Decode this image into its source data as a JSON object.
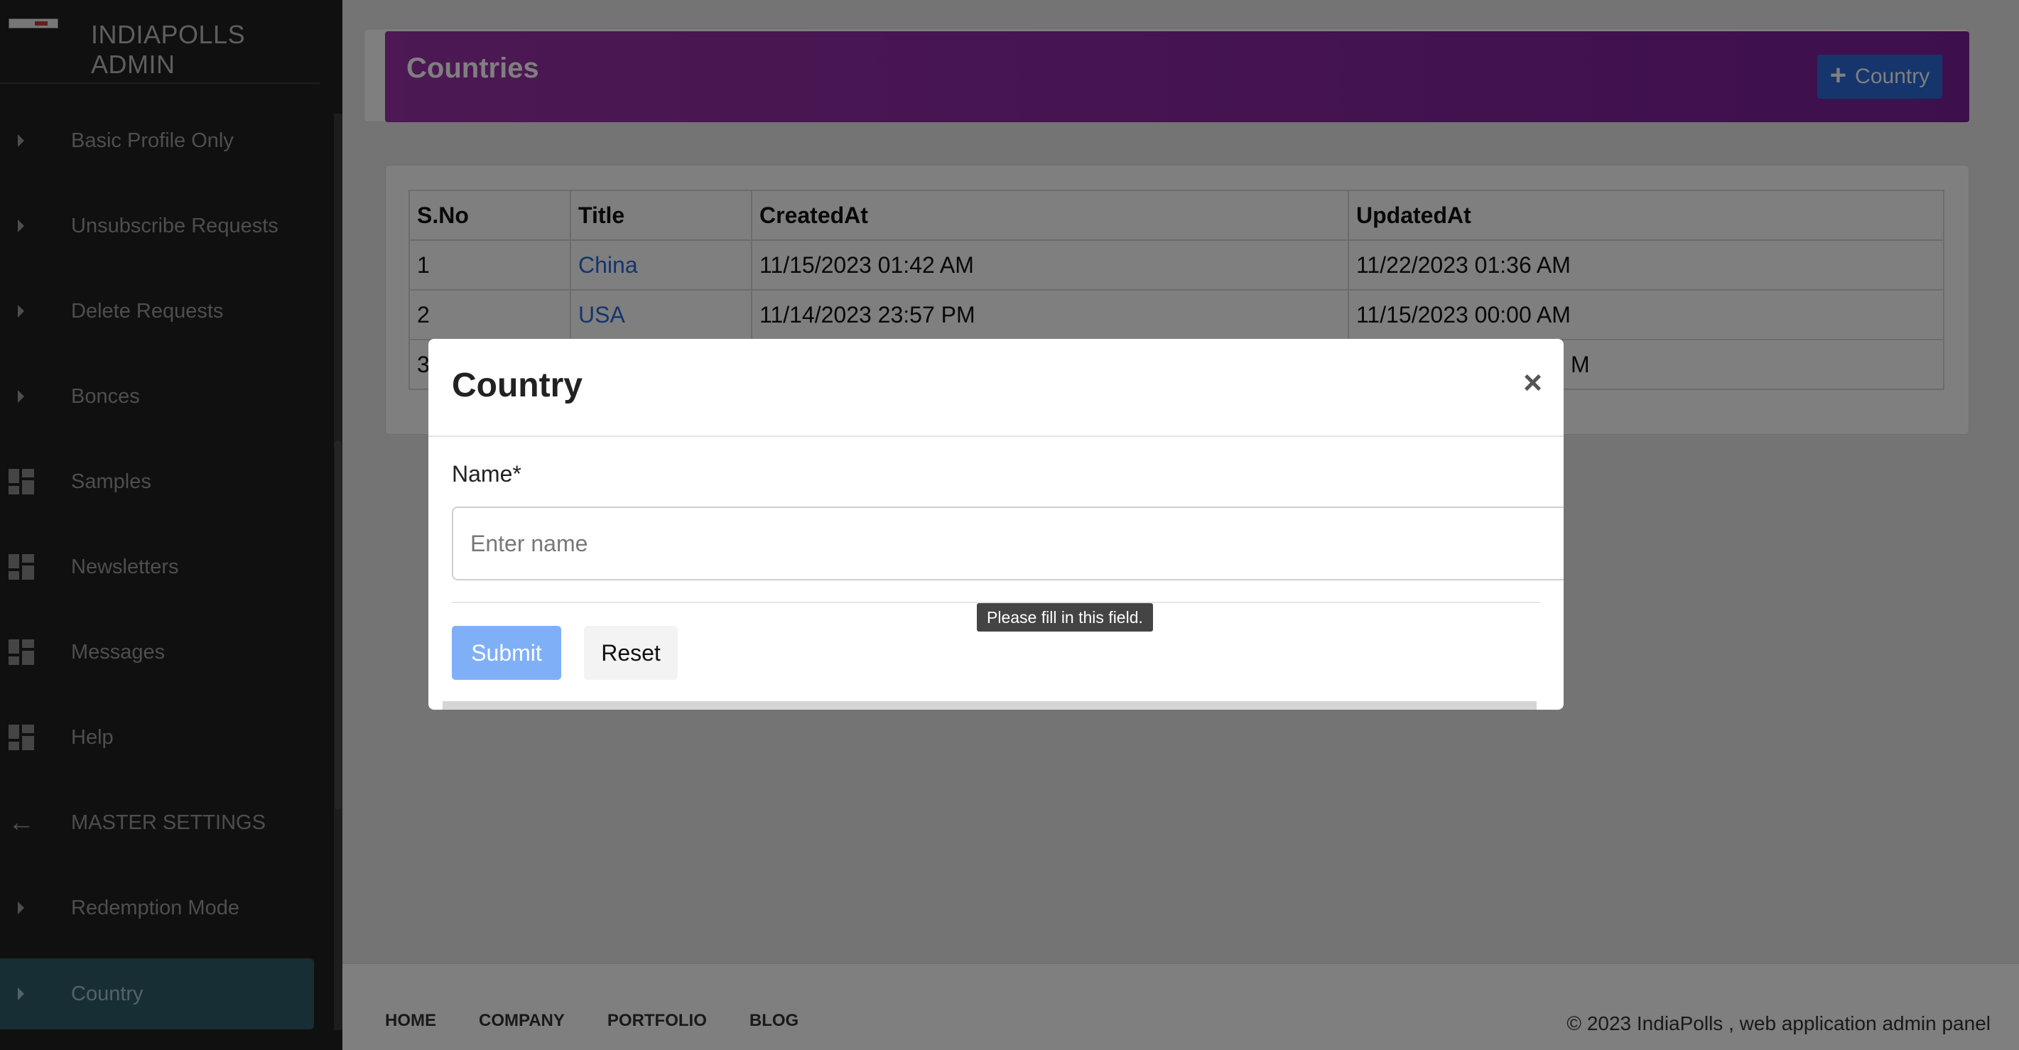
{
  "sidebar": {
    "brand_title": "INDIAPOLLS ADMIN",
    "items": [
      {
        "label": "Basic Profile Only",
        "icon": "caret-right-icon"
      },
      {
        "label": "Unsubscribe Requests",
        "icon": "caret-right-icon"
      },
      {
        "label": "Delete Requests",
        "icon": "caret-right-icon"
      },
      {
        "label": "Bonces",
        "icon": "caret-right-icon"
      },
      {
        "label": "Samples",
        "icon": "dashboard-icon"
      },
      {
        "label": "Newsletters",
        "icon": "dashboard-icon"
      },
      {
        "label": "Messages",
        "icon": "dashboard-icon"
      },
      {
        "label": "Help",
        "icon": "dashboard-icon"
      },
      {
        "label": "MASTER SETTINGS",
        "icon": "arrow-left-icon"
      },
      {
        "label": "Redemption Mode",
        "icon": "caret-right-icon"
      },
      {
        "label": "Country",
        "icon": "caret-right-icon",
        "active": true
      }
    ]
  },
  "header": {
    "title": "Countries",
    "add_button_label": "Country",
    "gradient_colors": [
      "#9a31a8",
      "#7b1f9b"
    ],
    "add_button_color": "#2a6bd8"
  },
  "table": {
    "columns": [
      "S.No",
      "Title",
      "CreatedAt",
      "UpdatedAt"
    ],
    "rows": [
      [
        "1",
        "China",
        "11/15/2023 01:42 AM",
        "11/22/2023 01:36 AM"
      ],
      [
        "2",
        "USA",
        "11/14/2023 23:57 PM",
        "11/15/2023 00:00 AM"
      ],
      [
        "3",
        "",
        "",
        "M"
      ]
    ]
  },
  "modal": {
    "title": "Country",
    "close_symbol": "×",
    "field_label": "Name*",
    "field_placeholder": "Enter name",
    "field_value": "",
    "tooltip": "Please fill in this field.",
    "submit_label": "Submit",
    "reset_label": "Reset"
  },
  "footer": {
    "links": [
      "HOME",
      "COMPANY",
      "PORTFOLIO",
      "BLOG"
    ],
    "copyright": "© 2023 IndiaPolls , web application admin panel"
  }
}
